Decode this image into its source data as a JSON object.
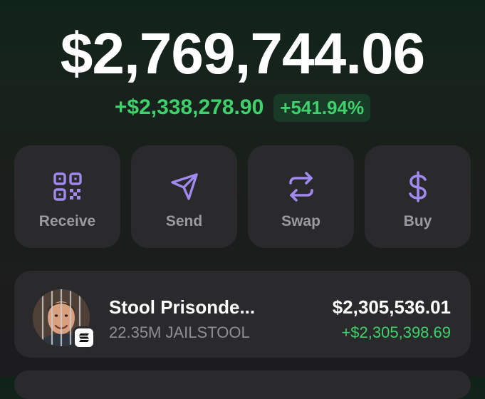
{
  "portfolio": {
    "balance": "$2,769,744.06",
    "change_amount": "+$2,338,278.90",
    "change_percent": "+541.94%"
  },
  "actions": [
    {
      "label": "Receive",
      "icon": "qr-code-icon"
    },
    {
      "label": "Send",
      "icon": "send-arrow-icon"
    },
    {
      "label": "Swap",
      "icon": "swap-arrows-icon"
    },
    {
      "label": "Buy",
      "icon": "dollar-sign-icon"
    }
  ],
  "tokens": [
    {
      "name": "Stool Prisonde...",
      "amount": "22.35M JAILSTOOL",
      "value": "$2,305,536.01",
      "change": "+$2,305,398.69",
      "chain_icon": "solana-icon"
    }
  ],
  "colors": {
    "accent_purple": "#a08af0",
    "positive_green": "#3fd16c",
    "card_bg": "#2a2a2d",
    "label_gray": "#9a9aa0"
  }
}
